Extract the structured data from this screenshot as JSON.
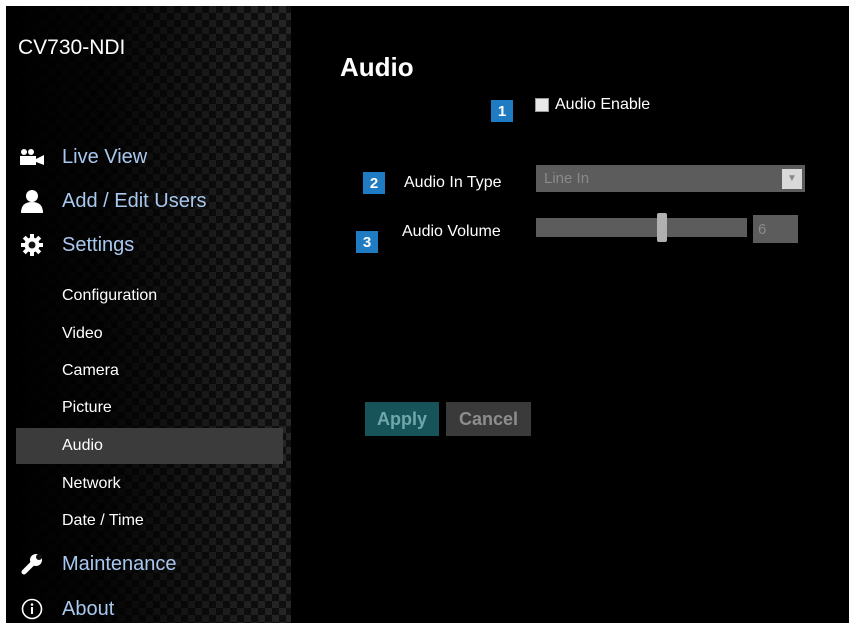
{
  "app": {
    "title": "CV730-NDI"
  },
  "nav": {
    "live_view": "Live View",
    "users": "Add / Edit Users",
    "settings": "Settings",
    "sub": [
      "Configuration",
      "Video",
      "Camera",
      "Picture",
      "Audio",
      "Network",
      "Date / Time"
    ],
    "active_sub": "Audio",
    "maintenance": "Maintenance",
    "about": "About"
  },
  "page": {
    "title": "Audio"
  },
  "badges": [
    "1",
    "2",
    "3"
  ],
  "audio_enable": {
    "label": "Audio Enable",
    "checked": false
  },
  "audio_in_type": {
    "label": "Audio In Type",
    "value": "Line In"
  },
  "audio_volume": {
    "label": "Audio Volume",
    "value": "6"
  },
  "buttons": {
    "apply": "Apply",
    "cancel": "Cancel"
  },
  "colors": {
    "accent_blue": "#1f7bc2",
    "nav_blue": "#a9c8ef",
    "apply_bg": "#16545a"
  }
}
